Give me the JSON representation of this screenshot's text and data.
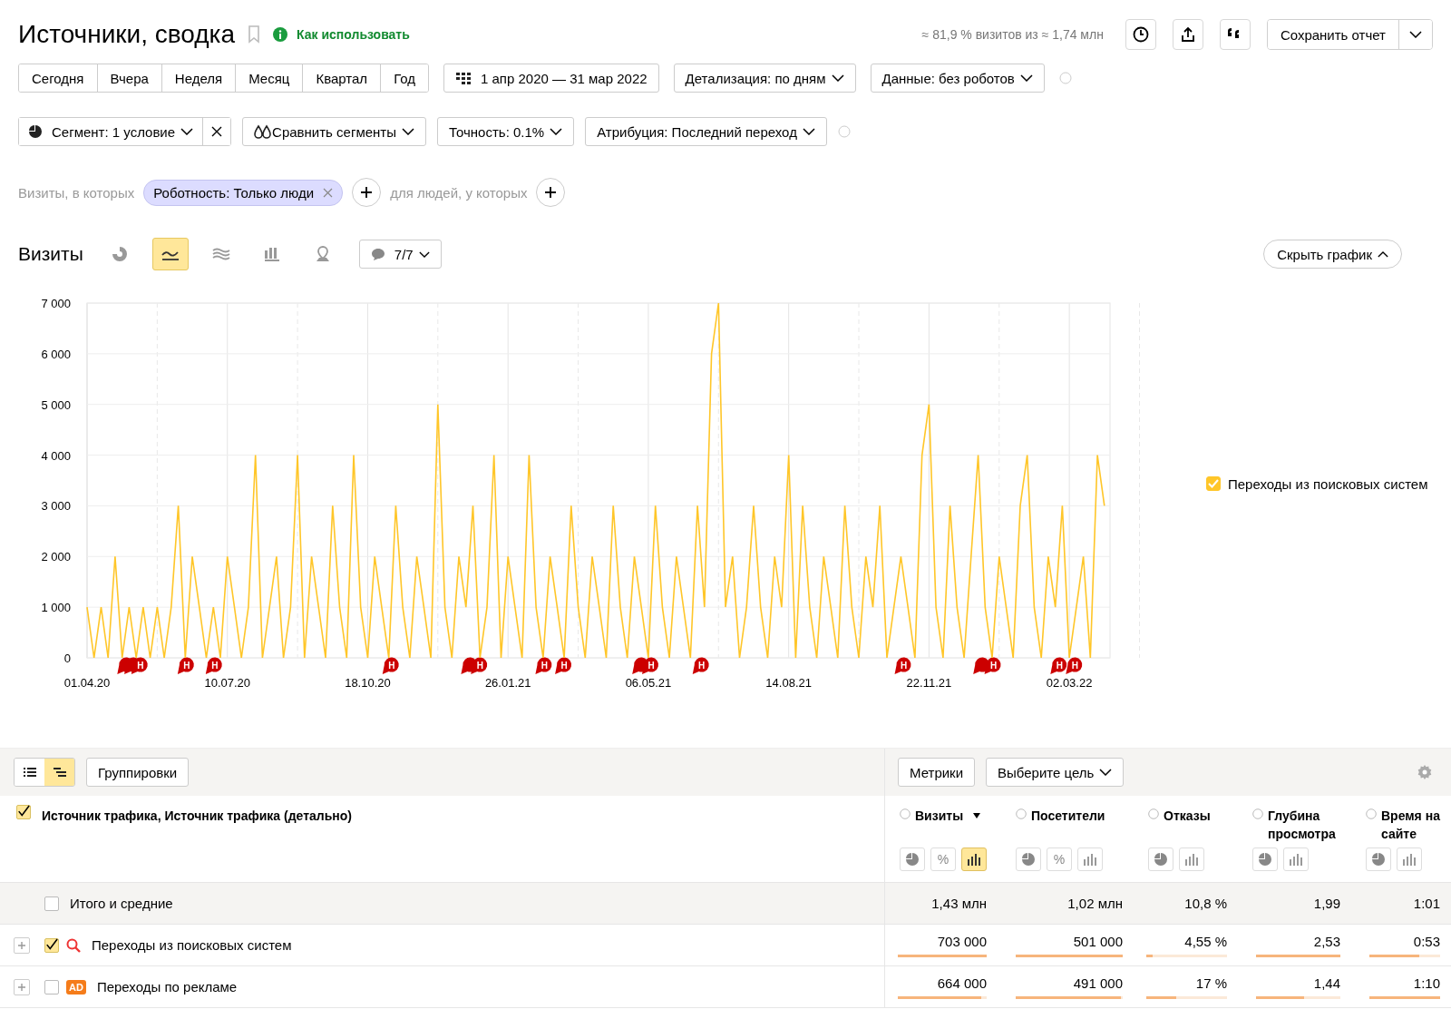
{
  "header": {
    "title": "Источники, сводка",
    "help_link": "Как использовать",
    "sample_note": "≈ 81,9 % визитов из ≈ 1,74 млн",
    "save_button": "Сохранить отчет"
  },
  "periods": [
    {
      "label": "Сегодня",
      "selected": false
    },
    {
      "label": "Вчера",
      "selected": false
    },
    {
      "label": "Неделя",
      "selected": false
    },
    {
      "label": "Месяц",
      "selected": false
    },
    {
      "label": "Квартал",
      "selected": false
    },
    {
      "label": "Год",
      "selected": false
    }
  ],
  "date_range": "1 апр 2020 — 31 мар 2022",
  "detail_dropdown": "Детализация: по дням",
  "data_dropdown": "Данные: без роботов",
  "segment": {
    "label": "Сегмент: 1 условие",
    "compare": "Сравнить сегменты",
    "accuracy": "Точность: 0.1%",
    "attribution": "Атрибуция: Последний переход"
  },
  "conditions": {
    "visits_label": "Визиты, в которых",
    "tag": "Роботность: Только люди",
    "people_label": "для людей, у которых"
  },
  "chart_panel": {
    "title": "Визиты",
    "chart_types": [
      {
        "kind": "pie",
        "selected": false
      },
      {
        "kind": "line",
        "selected": true
      },
      {
        "kind": "area",
        "selected": false
      },
      {
        "kind": "bar",
        "selected": false
      },
      {
        "kind": "map",
        "selected": false
      }
    ],
    "notes_dropdown": "7/7",
    "hide_button": "Скрыть график",
    "legend": [
      {
        "checked": true
      }
    ],
    "chart_data": {
      "type": "line",
      "categories": [
        "01.04.20",
        null,
        null,
        null,
        null,
        null,
        null,
        null,
        null,
        null,
        null,
        null,
        null,
        null,
        null,
        null,
        null,
        null,
        null,
        null,
        "10.07.20",
        null,
        null,
        null,
        null,
        null,
        null,
        null,
        null,
        null,
        null,
        null,
        null,
        null,
        null,
        null,
        null,
        null,
        null,
        null,
        "18.10.20",
        null,
        null,
        null,
        null,
        null,
        null,
        null,
        null,
        null,
        null,
        null,
        null,
        null,
        null,
        null,
        null,
        null,
        null,
        null,
        "26.01.21",
        null,
        null,
        null,
        null,
        null,
        null,
        null,
        null,
        null,
        null,
        null,
        null,
        null,
        null,
        null,
        null,
        null,
        null,
        null,
        "06.05.21",
        null,
        null,
        null,
        null,
        null,
        null,
        null,
        null,
        null,
        null,
        null,
        null,
        null,
        null,
        null,
        null,
        null,
        null,
        null,
        "14.08.21",
        null,
        null,
        null,
        null,
        null,
        null,
        null,
        null,
        null,
        null,
        null,
        null,
        null,
        null,
        null,
        null,
        null,
        null,
        null,
        "22.11.21",
        null,
        null,
        null,
        null,
        null,
        null,
        null,
        null,
        null,
        null,
        null,
        null,
        null,
        null,
        null,
        null,
        null,
        null,
        null,
        "02.03.22",
        null,
        null,
        null,
        null,
        null
      ],
      "series": [
        {
          "name": "Переходы из поисковых систем",
          "color": "#ffc629",
          "values": [
            1000,
            0,
            1000,
            0,
            2000,
            0,
            1000,
            0,
            1000,
            0,
            1000,
            0,
            1000,
            3000,
            0,
            2000,
            1000,
            0,
            1000,
            0,
            2000,
            1000,
            0,
            1000,
            4000,
            0,
            1000,
            2000,
            0,
            1000,
            4000,
            0,
            2000,
            1000,
            0,
            3000,
            1000,
            0,
            4000,
            1000,
            0,
            2000,
            1000,
            0,
            3000,
            1000,
            0,
            2000,
            1000,
            0,
            5000,
            1000,
            0,
            2000,
            1000,
            3000,
            0,
            1000,
            4000,
            0,
            2000,
            1000,
            0,
            4000,
            1000,
            0,
            2000,
            1000,
            0,
            3000,
            1000,
            0,
            2000,
            1000,
            0,
            3000,
            1000,
            0,
            2000,
            1000,
            0,
            3000,
            1000,
            0,
            2000,
            1000,
            0,
            3000,
            1000,
            6000,
            7000,
            1000,
            2000,
            0,
            1000,
            3000,
            1000,
            0,
            2000,
            1000,
            4000,
            0,
            3000,
            1000,
            0,
            2000,
            1000,
            0,
            3000,
            1000,
            0,
            2000,
            1000,
            3000,
            0,
            1000,
            2000,
            1000,
            0,
            4000,
            5000,
            1000,
            0,
            3000,
            1000,
            0,
            2000,
            4000,
            1000,
            0,
            2000,
            1000,
            0,
            3000,
            4000,
            1000,
            0,
            2000,
            1000,
            3000,
            0,
            1000,
            2000,
            0,
            4000,
            3000
          ]
        }
      ],
      "ylim": [
        0,
        7000
      ],
      "yticks": [
        {
          "value": 0,
          "label": "0"
        },
        {
          "value": 1000,
          "label": "1 000"
        },
        {
          "value": 2000,
          "label": "2 000"
        },
        {
          "value": 3000,
          "label": "3 000"
        },
        {
          "value": 4000,
          "label": "4 000"
        },
        {
          "value": 5000,
          "label": "5 000"
        },
        {
          "value": 6000,
          "label": "6 000"
        },
        {
          "value": 7000,
          "label": "7 000"
        }
      ],
      "grid": true,
      "annotations": [
        "Н",
        "Н",
        "Н",
        "Н",
        "Н",
        "Н",
        "Н",
        "Н",
        "Н",
        "Н",
        "Н",
        "Н",
        "Н"
      ]
    }
  },
  "table": {
    "view_modes": [
      {
        "kind": "list",
        "selected": false
      },
      {
        "kind": "tree",
        "selected": true
      }
    ],
    "groupings_button": "Группировки",
    "metrics_button": "Метрики",
    "goal_dropdown": "Выберите цель",
    "dimension_header": {
      "label": "Источник трафика, Источник трафика (детально)",
      "checked": true
    },
    "columns": [
      {
        "label": "Визиты",
        "sorted": true,
        "views": [
          {
            "kind": "pie",
            "selected": false
          },
          {
            "kind": "percent",
            "label": "%",
            "selected": false
          },
          {
            "kind": "bars",
            "selected": true
          }
        ]
      },
      {
        "label": "Посетители",
        "sorted": false,
        "views": [
          {
            "kind": "pie",
            "selected": false
          },
          {
            "kind": "percent",
            "label": "%",
            "selected": false
          },
          {
            "kind": "bars",
            "selected": false
          }
        ]
      },
      {
        "label": "Отказы",
        "sorted": false,
        "views": [
          {
            "kind": "pie",
            "selected": false
          },
          {
            "kind": "bars",
            "selected": false
          }
        ]
      },
      {
        "label": "Глубина просмотра",
        "sorted": false,
        "views": [
          {
            "kind": "pie",
            "selected": false
          },
          {
            "kind": "bars",
            "selected": false
          }
        ]
      },
      {
        "label": "Время на сайте",
        "sorted": false,
        "views": [
          {
            "kind": "pie",
            "selected": false
          },
          {
            "kind": "bars",
            "selected": false
          }
        ]
      }
    ],
    "rows": [
      {
        "kind": "total",
        "label": "Итого и средние",
        "checked": false,
        "cells": [
          {
            "value": "1,43 млн"
          },
          {
            "value": "1,02 млн"
          },
          {
            "value": "10,8 %"
          },
          {
            "value": "1,99"
          },
          {
            "value": "1:01"
          }
        ]
      },
      {
        "kind": "search",
        "label": "Переходы из поисковых систем",
        "checked": true,
        "cells": [
          {
            "value": "703 000",
            "level": 1
          },
          {
            "value": "501 000",
            "level": 1
          },
          {
            "value": "4,55 %",
            "level": 0.08
          },
          {
            "value": "2,53",
            "level": 1
          },
          {
            "value": "0:53",
            "level": 0.7
          }
        ]
      },
      {
        "kind": "ads",
        "badge": "AD",
        "label": "Переходы по рекламе",
        "checked": false,
        "cells": [
          {
            "value": "664 000",
            "level": 0.94
          },
          {
            "value": "491 000",
            "level": 0.98
          },
          {
            "value": "17 %",
            "level": 0.37
          },
          {
            "value": "1,44",
            "level": 0.57
          },
          {
            "value": "1:10",
            "level": 1
          }
        ]
      }
    ]
  }
}
